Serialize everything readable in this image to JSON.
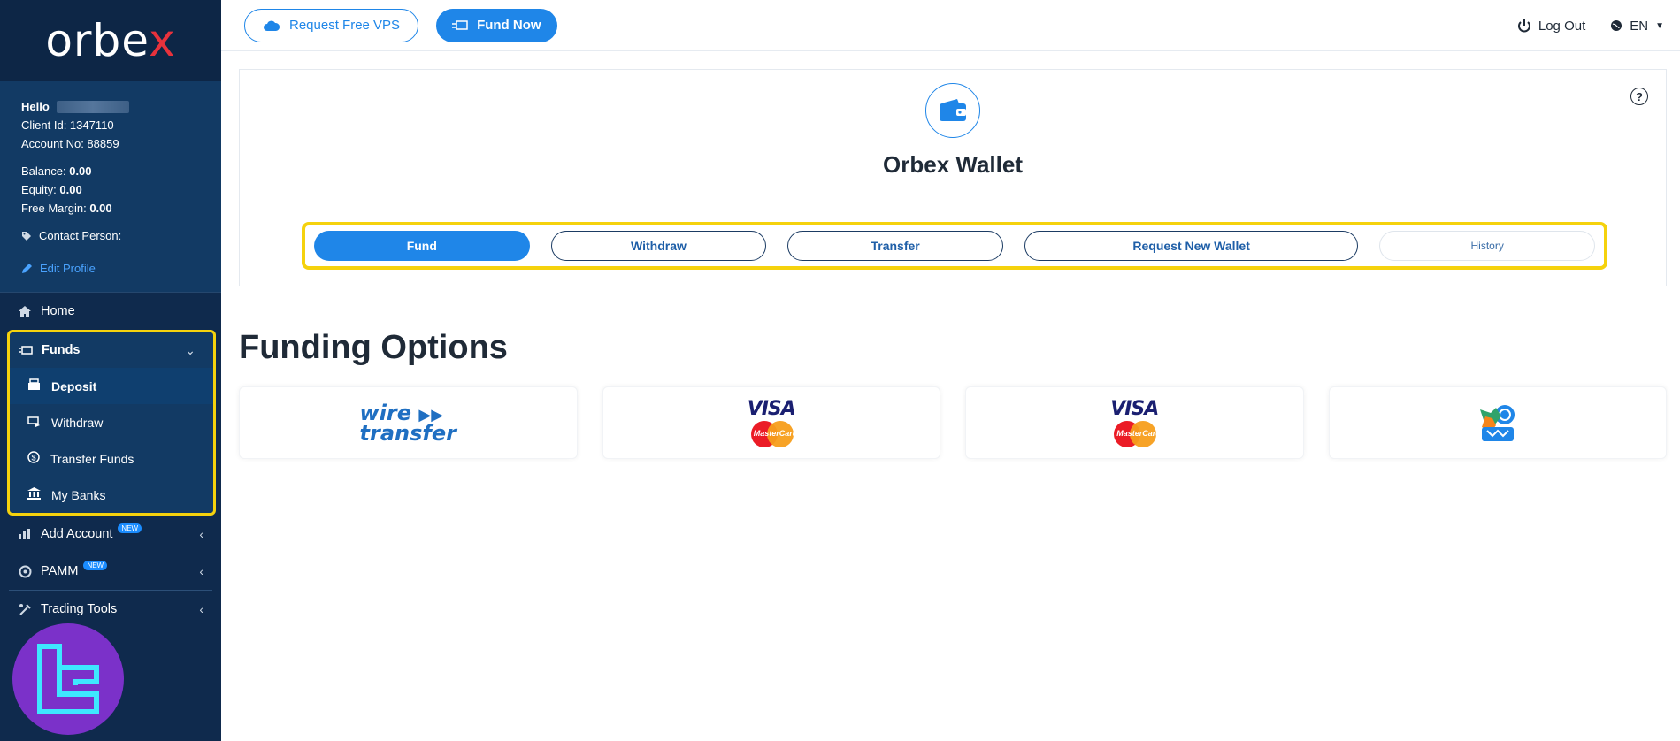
{
  "brand": {
    "logo_prefix": "orbe",
    "logo_x": "x"
  },
  "profile": {
    "hello": "Hello",
    "client_id": "Client Id: 1347110",
    "account_no": "Account No: 88859",
    "balance_label": "Balance:",
    "balance_value": "0.00",
    "equity_label": "Equity:",
    "equity_value": "0.00",
    "free_margin_label": "Free Margin:",
    "free_margin_value": "0.00",
    "contact_person": "Contact Person:",
    "edit_profile": "Edit Profile"
  },
  "nav": {
    "home": "Home",
    "funds": "Funds",
    "funds_sub": [
      "Deposit",
      "Withdraw",
      "Transfer Funds",
      "My Banks"
    ],
    "add_account": "Add Account",
    "pamm": "PAMM",
    "trading_tools": "Trading Tools",
    "new_badge": "NEW"
  },
  "topbar": {
    "request_vps": "Request Free VPS",
    "fund_now": "Fund Now",
    "log_out": "Log Out",
    "language": "EN"
  },
  "wallet": {
    "title": "Orbex Wallet",
    "help": "?",
    "tabs": [
      "Fund",
      "Withdraw",
      "Transfer",
      "Request New Wallet",
      "History"
    ],
    "active_tab": "Fund"
  },
  "funding": {
    "title": "Funding Options",
    "wire_line1": "wire",
    "wire_line2": "transfer",
    "visa": "VISA",
    "mastercard": "MasterCard"
  },
  "colors": {
    "accent": "#1f86e8",
    "sidebar": "#0f2a4d",
    "highlight": "#f5d20d"
  }
}
